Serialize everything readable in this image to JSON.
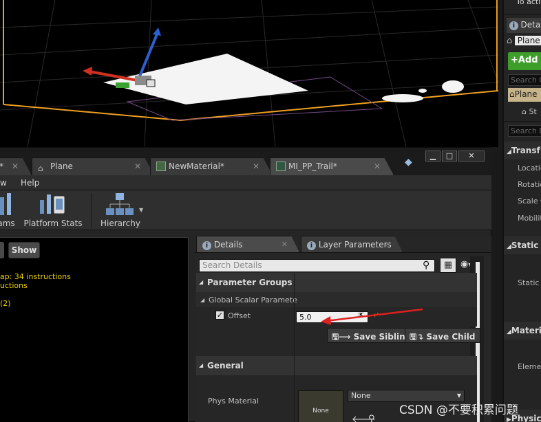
{
  "right_panel": {
    "top_text": "To activ",
    "details_tab": "Deta",
    "actor_name": "Plane",
    "add_label": "Add",
    "search_components": "Search C",
    "component_selected": "Plane",
    "component_child": "St",
    "search_details": "Search D",
    "categories": {
      "transform": "Transf",
      "static": "Static",
      "materials": "Materi",
      "physics": "Physic"
    },
    "props": {
      "location": "Locatio",
      "rotation": "Rotatio",
      "scale": "Scale",
      "mobility": "Mobility",
      "static_mesh": "Static N",
      "element": "Elemen"
    }
  },
  "editor": {
    "tabs": [
      {
        "label": "*"
      },
      {
        "label": "Plane"
      },
      {
        "label": "NewMaterial*"
      },
      {
        "label": "MI_PP_Trail*"
      }
    ],
    "window_buttons": {
      "minimize": "▁",
      "maximize": "□",
      "close": "✕"
    },
    "menu": {
      "view_partial": "w",
      "help": "Help"
    },
    "toolbar": {
      "params_partial": "ams",
      "platform_stats": "Platform Stats",
      "hierarchy": "Hierarchy"
    },
    "stats": {
      "show_label": "Show",
      "line1": "ap: 34 instructions",
      "line2": "uctions",
      "line3": "(2)"
    },
    "details": {
      "tabs": {
        "details": "Details",
        "layer_parameters": "Layer Parameters"
      },
      "search_placeholder": "Search Details",
      "parameter_groups": "Parameter Groups",
      "global_scalar": "Global Scalar Paramete",
      "offset_label": "Offset",
      "offset_value": "5.0",
      "save_sibling": "Save Sibling",
      "save_child": "Save Child",
      "general": "General",
      "phys_material": "Phys Material",
      "thumb_text": "None",
      "phys_combo": "None"
    }
  },
  "watermark": "CSDN @不要积累问题",
  "colors": {
    "arrow_annotation": "#e02020",
    "stats_text": "#e8d100",
    "add_button": "#3d9e2a",
    "selection_outline": "#f0a020"
  }
}
